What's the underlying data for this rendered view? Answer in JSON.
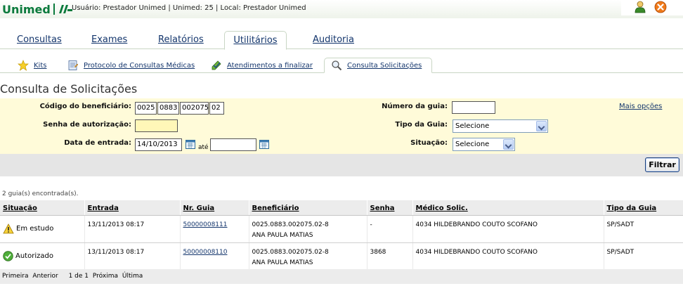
{
  "header": {
    "logo_text": "Unimed",
    "user_info": "Usuário: Prestador Unimed | Unimed: 25 | Local: Prestador Unimed"
  },
  "top_tabs": [
    {
      "label": "Consultas",
      "active": false
    },
    {
      "label": "Exames",
      "active": false
    },
    {
      "label": "Relatórios",
      "active": false
    },
    {
      "label": "Utilitários",
      "active": true
    },
    {
      "label": "Auditoria",
      "active": false
    }
  ],
  "sub_tabs": [
    {
      "label": "Kits",
      "icon": "star-icon"
    },
    {
      "label": "Protocolo de Consultas Médicas",
      "icon": "clipboard-icon"
    },
    {
      "label": "Atendimentos a finalizar",
      "icon": "pencil-check-icon"
    },
    {
      "label": "Consulta Solicitações",
      "icon": "magnifier-icon",
      "active": true
    }
  ],
  "page_title": "Consulta de Solicitações",
  "filters": {
    "beneficiario_label": "Código do beneficiário:",
    "beneficiario_parts": [
      "0025",
      "0883",
      "002075",
      "02"
    ],
    "senha_label": "Senha de autorização:",
    "senha_value": "",
    "data_label": "Data de entrada:",
    "data_inicio": "14/10/2013",
    "ate_label": "até",
    "data_fim": "",
    "numero_guia_label": "Número da guia:",
    "numero_guia_value": "",
    "tipo_guia_label": "Tipo da Guia:",
    "tipo_guia_value": "Selecione",
    "situacao_label": "Situação:",
    "situacao_value": "Selecione",
    "mais_opcoes": "Mais opções"
  },
  "filtrar_label": "Filtrar",
  "result_count": "2 guia(s) encontrada(s).",
  "table": {
    "headers": [
      "Situação",
      "Entrada",
      "Nr. Guia",
      "Beneficiário",
      "Senha",
      "Médico Solic.",
      "Tipo da Guia"
    ],
    "rows": [
      {
        "situacao": "Em estudo",
        "status_icon": "warning-icon",
        "entrada": "13/11/2013 08:17",
        "nr_guia": "50000008111",
        "benef_code": "0025.0883.002075.02-8",
        "benef_name": "ANA PAULA MATIAS",
        "senha": "-",
        "medico": "4034 HILDEBRANDO COUTO SCOFANO",
        "tipo": "SP/SADT"
      },
      {
        "situacao": "Autorizado",
        "status_icon": "check-icon",
        "entrada": "13/11/2013 08:17",
        "nr_guia": "50000008110",
        "benef_code": "0025.0883.002075.02-8",
        "benef_name": "ANA PAULA MATIAS",
        "senha": "3868",
        "medico": "4034 HILDEBRANDO COUTO SCOFANO",
        "tipo": "SP/SADT"
      }
    ]
  },
  "pager": {
    "first": "Primeira",
    "prev": "Anterior",
    "page_info": "1 de 1",
    "next": "Próxima",
    "last": "Última"
  },
  "colors": {
    "brand_green": "#0a7a3c",
    "link_blue": "#13356c",
    "filter_bg": "#fffbd9"
  }
}
